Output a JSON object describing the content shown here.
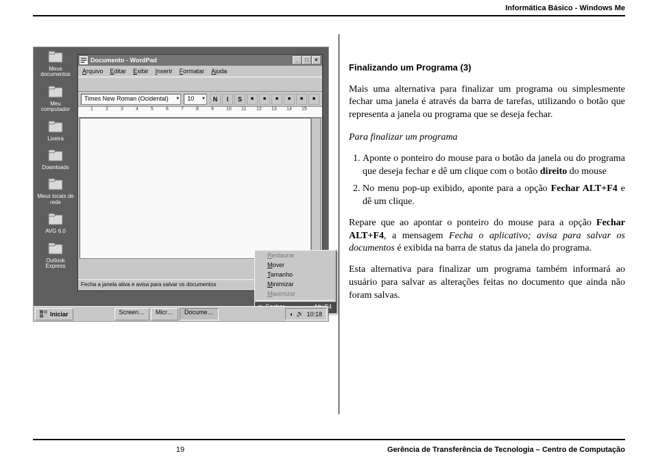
{
  "header": {
    "title": "Informática Básico - Windows Me"
  },
  "footer": {
    "page": "19",
    "org": "Gerência de Transferência de Tecnologia – Centro de Computação"
  },
  "article": {
    "heading": "Finalizando um Programa (3)",
    "intro": "Mais uma alternativa para finalizar um programa ou simplesmente fechar uma janela é através da barra de tarefas, utilizando o botão que representa a janela ou programa que se deseja fechar.",
    "subhead": "Para finalizar um programa",
    "steps_raw": [
      "Aponte o ponteiro do mouse para o botão da janela ou do programa que deseja fechar e dê um clique com o botão <b class='strong'>direito</b> do mouse",
      "No menu pop-up exibido, aponte para a opção <b class='strong'>Fechar ALT+F4</b> e dê um clique."
    ],
    "note_raw": "Repare que ao apontar o ponteiro do mouse para a opção <b class='strong'>Fechar ALT+F4</b>, a mensagem <i class='em'>Fecha o aplicativo; avisa para salvar os documentos</i> é exibida na barra de status da janela do programa.",
    "closing": "Esta alternativa para finalizar um programa também informará ao usuário para salvar as alterações feitas no documento que ainda não foram salvas."
  },
  "screenshot": {
    "desktop_icons": [
      {
        "label": "Meus documentos"
      },
      {
        "label": "Meu computador"
      },
      {
        "label": "Lixeira"
      },
      {
        "label": "Downloads"
      },
      {
        "label": "Meus locais de rede"
      },
      {
        "label": "AVG 6.0"
      },
      {
        "label": "Outlook Express"
      }
    ],
    "window": {
      "title": "Documento - WordPad",
      "menus": [
        "Arquivo",
        "Editar",
        "Exibir",
        "Inserir",
        "Formatar",
        "Ajuda"
      ],
      "font_name": "Times New Roman (Ocidental)",
      "font_size": "10",
      "format_buttons": [
        "N",
        "I",
        "S"
      ],
      "status": "Fecha a janela ativa e avisa para salvar os documentos"
    },
    "context_menu": {
      "items": [
        {
          "label": "Restaurar",
          "enabled": false
        },
        {
          "label": "Mover",
          "enabled": true
        },
        {
          "label": "Tamanho",
          "enabled": true
        },
        {
          "label": "Minimizar",
          "enabled": true
        },
        {
          "label": "Maximizar",
          "enabled": false
        }
      ],
      "selected": {
        "label": "Fechar",
        "shortcut": "Alt+F4"
      }
    },
    "taskbar": {
      "start": "Iniciar",
      "tasks": [
        "Screen…",
        "Micr…",
        "Docume…"
      ],
      "clock": "10:18"
    },
    "ruler_max": 15
  }
}
